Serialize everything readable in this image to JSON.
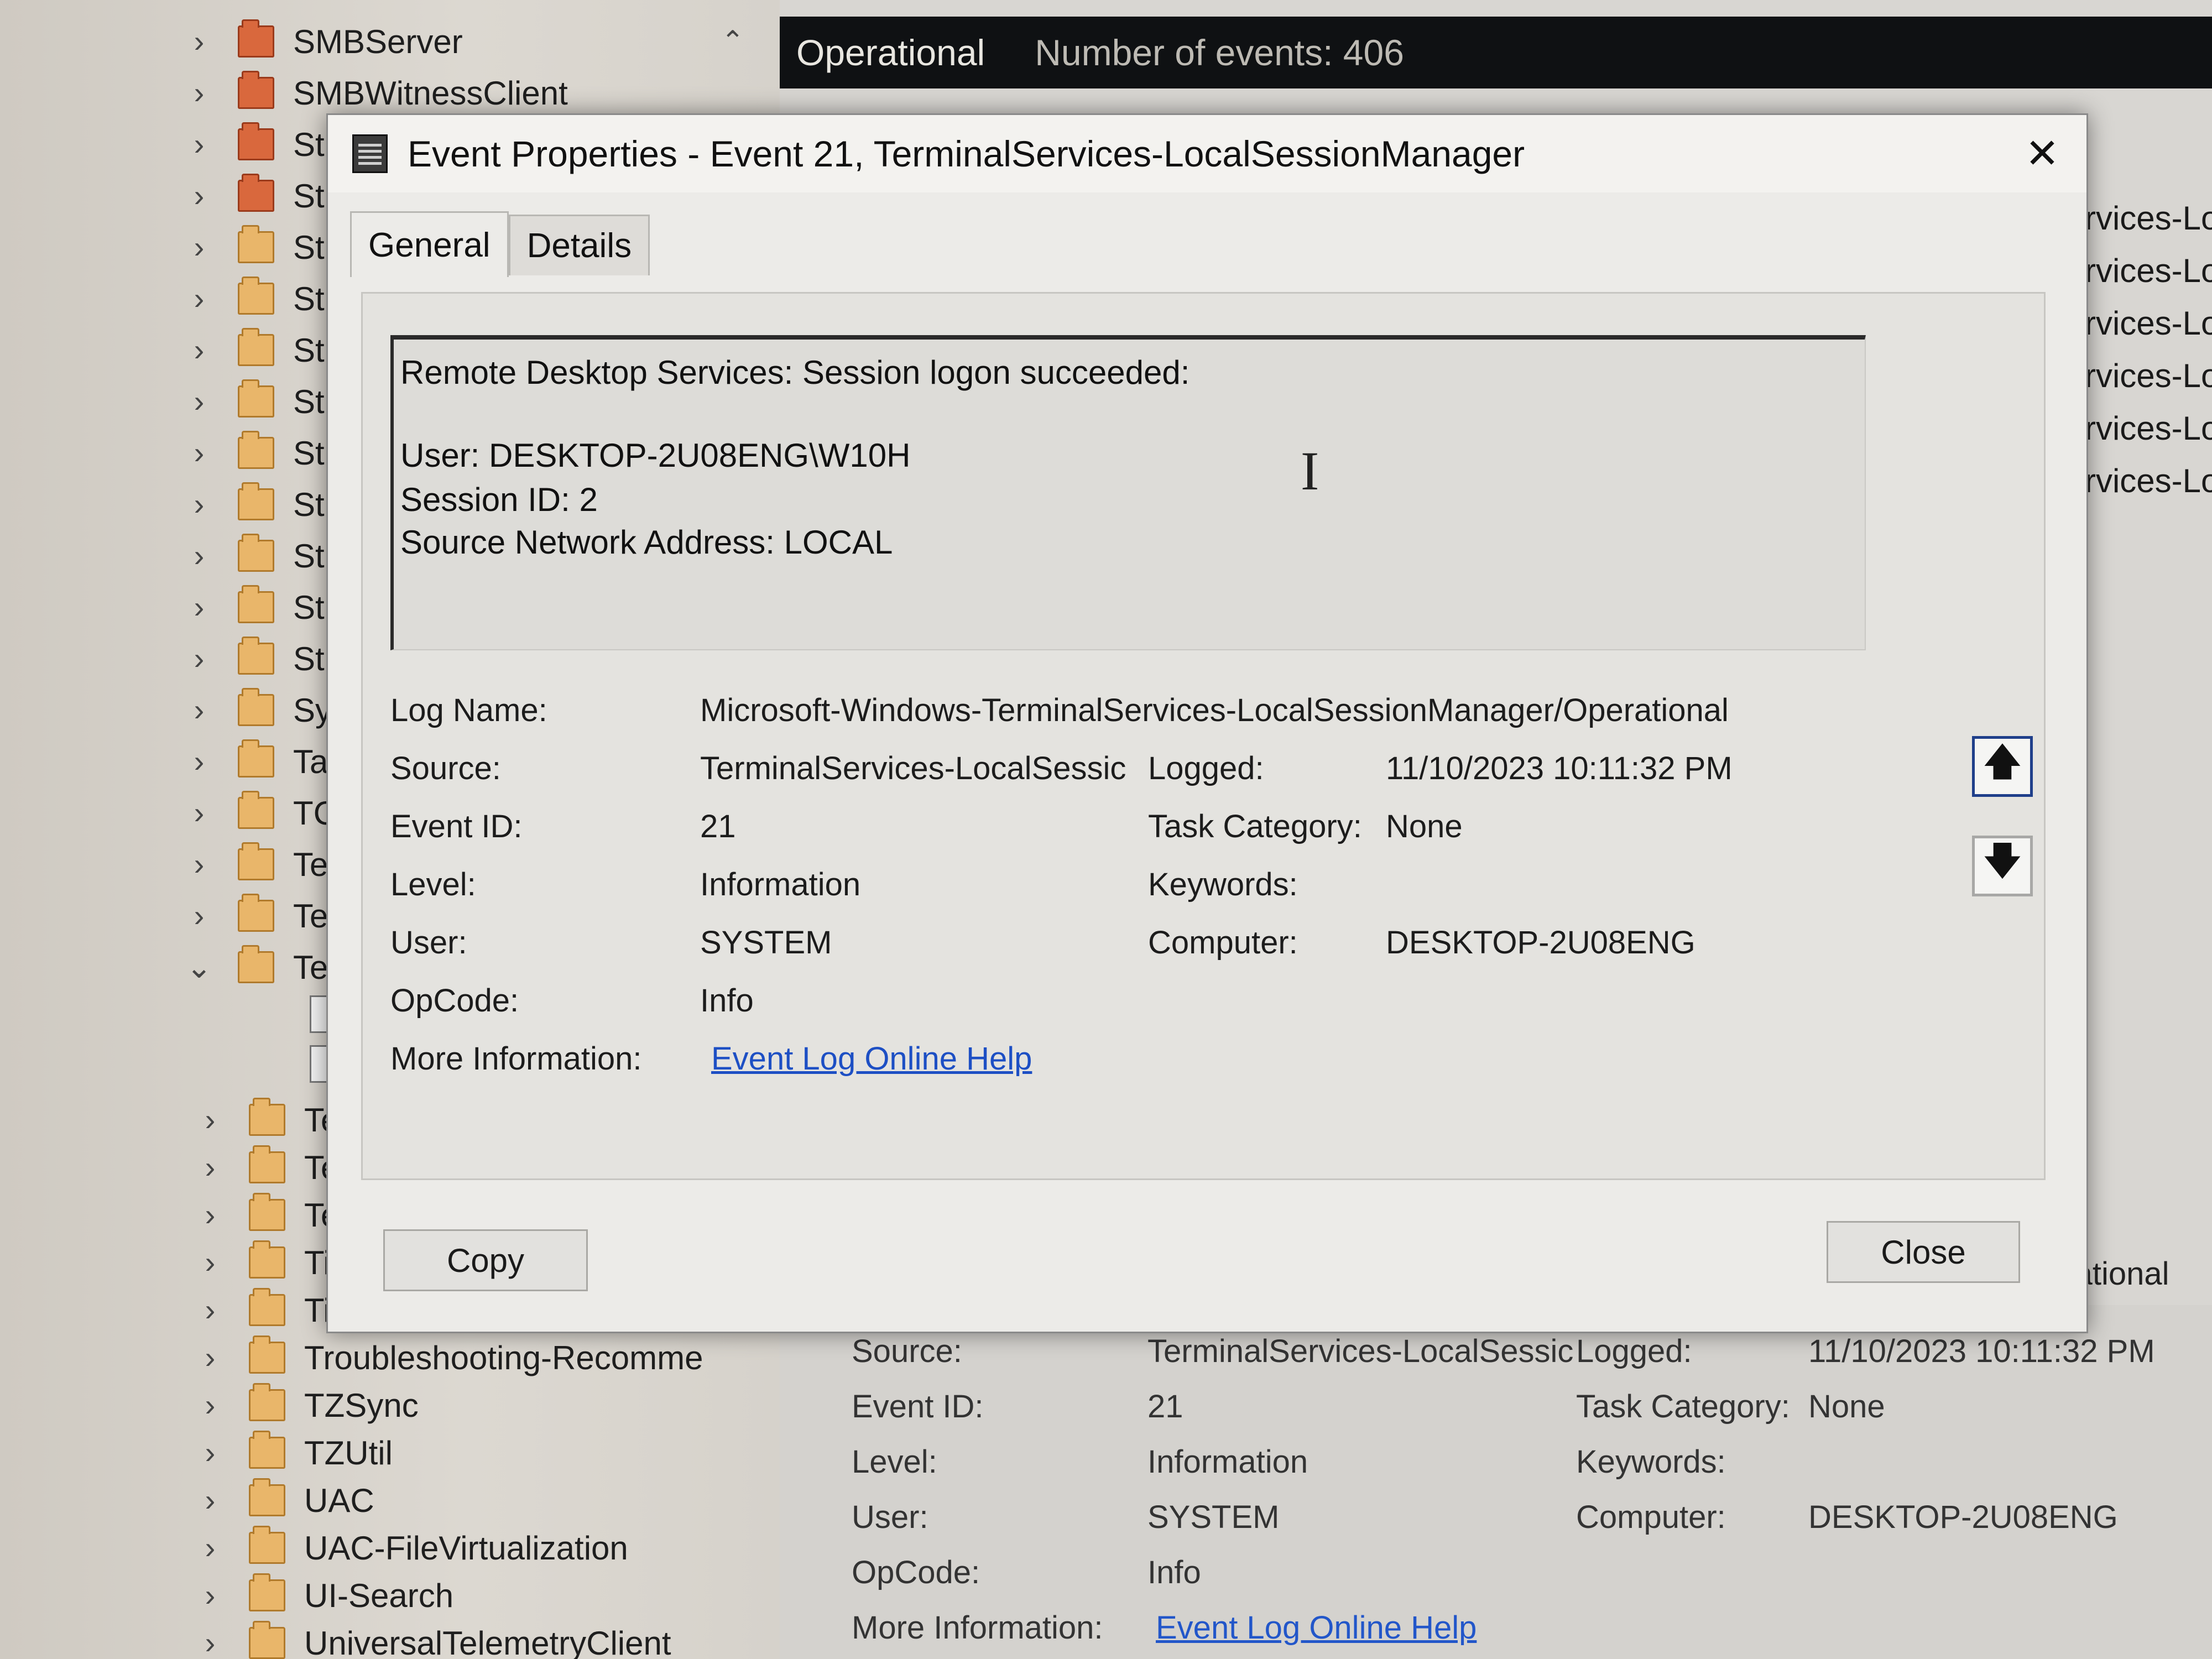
{
  "tree": {
    "items": [
      {
        "label": "SMBServer",
        "icon": "folder-red-icon",
        "chevron": "›"
      },
      {
        "label": "SMBWitnessClient",
        "icon": "folder-red-icon",
        "chevron": "›"
      },
      {
        "label": "St",
        "icon": "folder-red-icon",
        "chevron": "›"
      },
      {
        "label": "St",
        "icon": "folder-red-icon",
        "chevron": "›"
      },
      {
        "label": "St",
        "icon": "folder-icon",
        "chevron": "›"
      },
      {
        "label": "St",
        "icon": "folder-icon",
        "chevron": "›"
      },
      {
        "label": "St",
        "icon": "folder-icon",
        "chevron": "›"
      },
      {
        "label": "St",
        "icon": "folder-icon",
        "chevron": "›"
      },
      {
        "label": "St",
        "icon": "folder-icon",
        "chevron": "›"
      },
      {
        "label": "St",
        "icon": "folder-icon",
        "chevron": "›"
      },
      {
        "label": "St",
        "icon": "folder-icon",
        "chevron": "›"
      },
      {
        "label": "St",
        "icon": "folder-icon",
        "chevron": "›"
      },
      {
        "label": "St",
        "icon": "folder-icon",
        "chevron": "›"
      },
      {
        "label": "Sy",
        "icon": "folder-icon",
        "chevron": "›"
      },
      {
        "label": "Ta",
        "icon": "folder-icon",
        "chevron": "›"
      },
      {
        "label": "TC",
        "icon": "folder-icon",
        "chevron": "›"
      },
      {
        "label": "Te",
        "icon": "folder-icon",
        "chevron": "›"
      },
      {
        "label": "Te",
        "icon": "folder-icon",
        "chevron": "›"
      },
      {
        "label": "Te",
        "icon": "folder-icon",
        "chevron": "⌄"
      }
    ],
    "lower_items": [
      {
        "label": "Te",
        "chevron": "›"
      },
      {
        "label": "Te",
        "chevron": "›"
      },
      {
        "label": "Te",
        "chevron": "›"
      },
      {
        "label": "Ti",
        "chevron": "›"
      },
      {
        "label": "Ti",
        "chevron": "›"
      },
      {
        "label": "Troubleshooting-Recomme",
        "chevron": "›"
      },
      {
        "label": "TZSync",
        "chevron": "›"
      },
      {
        "label": "TZUtil",
        "chevron": "›"
      },
      {
        "label": "UAC",
        "chevron": "›"
      },
      {
        "label": "UAC-FileVirtualization",
        "chevron": "›"
      },
      {
        "label": "UI-Search",
        "chevron": "›"
      },
      {
        "label": "UniversalTelemetryClient",
        "chevron": "›"
      }
    ],
    "scroll_up": "⌃"
  },
  "right_pane": {
    "header_log": "Operational",
    "header_count": "Number of events: 406",
    "list_items": [
      "rvices-Lo",
      "rvices-Lo",
      "rvices-Lo",
      "rvices-Lo",
      "rvices-Lo",
      "rvices-Lo"
    ],
    "operational_fragment": "erational",
    "details": {
      "source_label": "Source:",
      "source_value": "TerminalServices-LocalSessic",
      "logged_label": "Logged:",
      "logged_value": "11/10/2023 10:11:32 PM",
      "event_id_label": "Event ID:",
      "event_id_value": "21",
      "task_label": "Task Category:",
      "task_value": "None",
      "level_label": "Level:",
      "level_value": "Information",
      "keywords_label": "Keywords:",
      "user_label": "User:",
      "user_value": "SYSTEM",
      "computer_label": "Computer:",
      "computer_value": "DESKTOP-2U08ENG",
      "opcode_label": "OpCode:",
      "opcode_value": "Info",
      "more_label": "More Information:",
      "more_link": "Event Log Online Help"
    }
  },
  "dialog": {
    "title": "Event Properties - Event 21, TerminalServices-LocalSessionManager",
    "close_glyph": "✕",
    "tabs": [
      "General",
      "Details"
    ],
    "message": {
      "line1": "Remote Desktop Services: Session logon succeeded:",
      "line2": "User: DESKTOP-2U08ENG\\W10H",
      "line3": "Session ID: 2",
      "line4": "Source Network Address: LOCAL"
    },
    "fields": {
      "log_name_label": "Log Name:",
      "log_name_value": "Microsoft-Windows-TerminalServices-LocalSessionManager/Operational",
      "source_label": "Source:",
      "source_value": "TerminalServices-LocalSessic",
      "logged_label": "Logged:",
      "logged_value": "11/10/2023 10:11:32 PM",
      "event_id_label": "Event ID:",
      "event_id_value": "21",
      "task_label": "Task Category:",
      "task_value": "None",
      "level_label": "Level:",
      "level_value": "Information",
      "keywords_label": "Keywords:",
      "user_label": "User:",
      "user_value": "SYSTEM",
      "computer_label": "Computer:",
      "computer_value": "DESKTOP-2U08ENG",
      "opcode_label": "OpCode:",
      "opcode_value": "Info",
      "more_label": "More Information:",
      "more_link": "Event Log Online Help"
    },
    "nav_up": "🡅",
    "nav_down": "🡇",
    "copy_button": "Copy",
    "close_button": "Close",
    "text_cursor": "I"
  }
}
